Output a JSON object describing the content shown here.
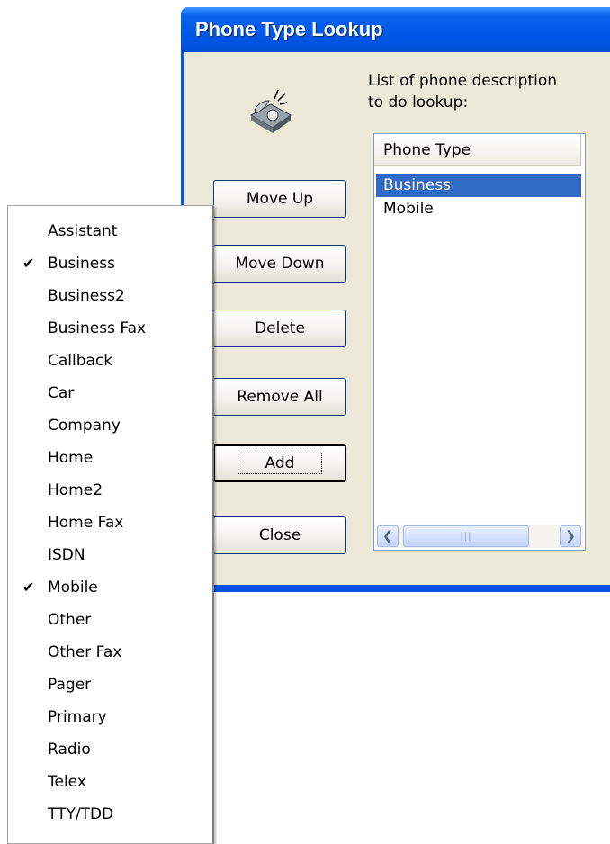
{
  "window": {
    "title": "Phone Type Lookup"
  },
  "list_label": "List of phone description\nto do lookup:",
  "buttons": {
    "move_up": "Move Up",
    "move_down": "Move Down",
    "delete": "Delete",
    "remove_all": "Remove All",
    "add": "Add",
    "close": "Close"
  },
  "listview": {
    "column_header": "Phone Type",
    "rows": [
      {
        "label": "Business",
        "selected": true
      },
      {
        "label": "Mobile",
        "selected": false
      }
    ]
  },
  "menu": {
    "items": [
      {
        "label": "Assistant",
        "checked": false
      },
      {
        "label": "Business",
        "checked": true
      },
      {
        "label": "Business2",
        "checked": false
      },
      {
        "label": "Business Fax",
        "checked": false
      },
      {
        "label": "Callback",
        "checked": false
      },
      {
        "label": "Car",
        "checked": false
      },
      {
        "label": "Company",
        "checked": false
      },
      {
        "label": "Home",
        "checked": false
      },
      {
        "label": "Home2",
        "checked": false
      },
      {
        "label": "Home Fax",
        "checked": false
      },
      {
        "label": "ISDN",
        "checked": false
      },
      {
        "label": "Mobile",
        "checked": true
      },
      {
        "label": "Other",
        "checked": false
      },
      {
        "label": "Other Fax",
        "checked": false
      },
      {
        "label": "Pager",
        "checked": false
      },
      {
        "label": "Primary",
        "checked": false
      },
      {
        "label": "Radio",
        "checked": false
      },
      {
        "label": "Telex",
        "checked": false
      },
      {
        "label": "TTY/TDD",
        "checked": false
      }
    ]
  },
  "icons": {
    "phone": "ringing-telephone-icon",
    "check": "checkmark-icon",
    "scroll_left": "scroll-left-arrow-icon",
    "scroll_right": "scroll-right-arrow-icon"
  },
  "colors": {
    "titlebar": "#0058e6",
    "dialog_bg": "#ece9d8",
    "selection": "#316ac5"
  }
}
